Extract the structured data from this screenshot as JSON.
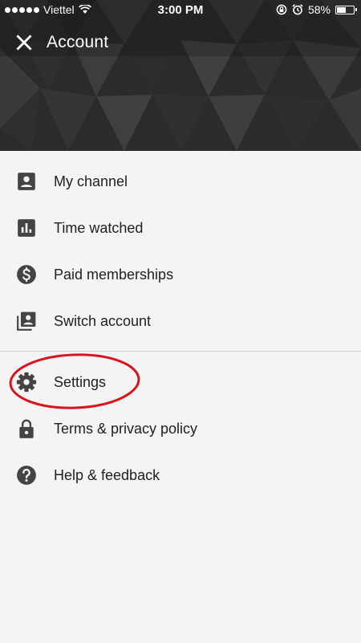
{
  "status_bar": {
    "carrier": "Viettel",
    "time": "3:00 PM",
    "battery_percent": "58%",
    "battery_level": 0.58
  },
  "header": {
    "title": "Account",
    "close_icon": "close-icon"
  },
  "menu": {
    "primary": [
      {
        "label": "My channel",
        "icon": "account-box-icon"
      },
      {
        "label": "Time watched",
        "icon": "bar-chart-icon"
      },
      {
        "label": "Paid memberships",
        "icon": "dollar-icon"
      },
      {
        "label": "Switch account",
        "icon": "switch-account-icon"
      }
    ],
    "secondary": [
      {
        "label": "Settings",
        "icon": "gear-icon"
      },
      {
        "label": "Terms & privacy policy",
        "icon": "lock-icon"
      },
      {
        "label": "Help & feedback",
        "icon": "help-icon"
      }
    ]
  },
  "colors": {
    "header_bg": "#2a2a2a",
    "page_bg": "#f4f4f4",
    "icon": "#444444",
    "highlight": "#d9141c"
  }
}
